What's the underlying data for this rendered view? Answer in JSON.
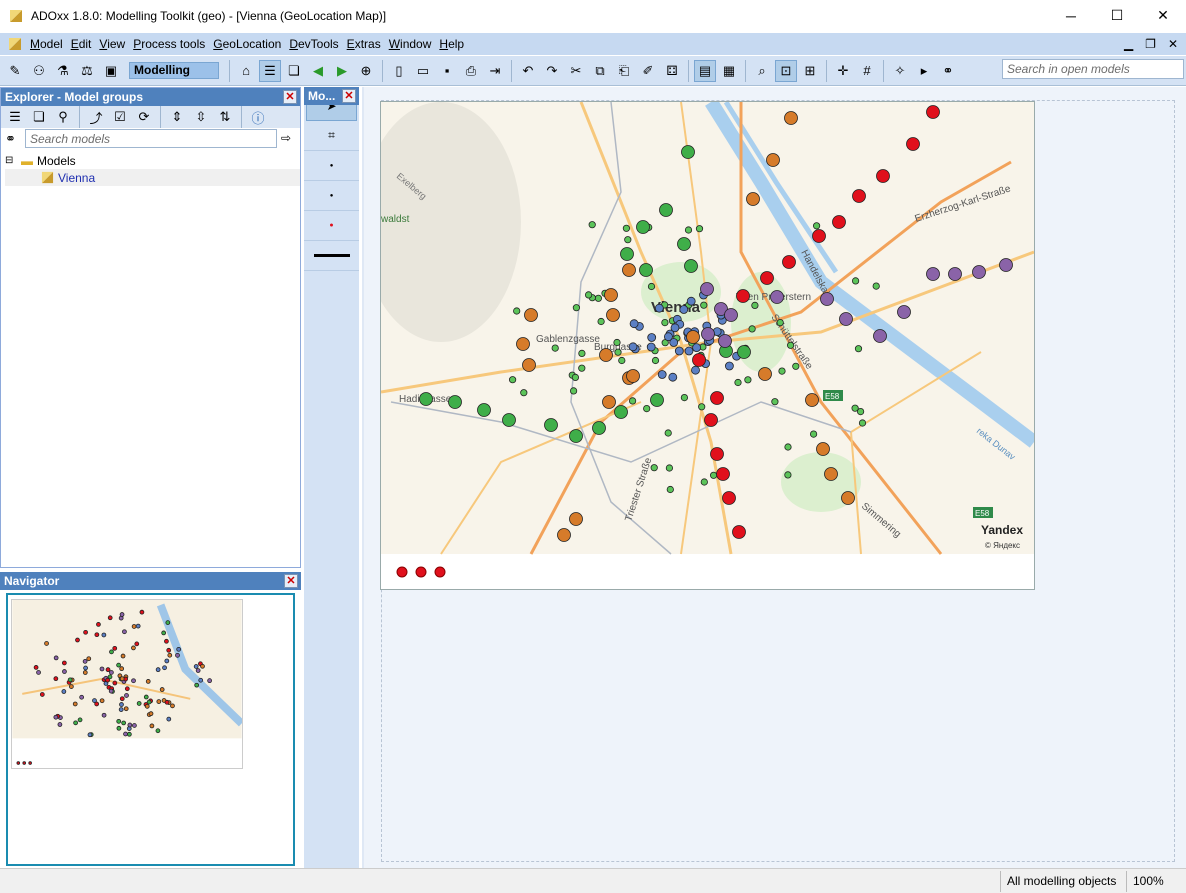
{
  "window": {
    "title": "ADOxx 1.8.0: Modelling Toolkit (geo) - [Vienna (GeoLocation Map)]",
    "minimize": "─",
    "maximize": "☐",
    "close": "✕"
  },
  "menu": [
    "Model",
    "Edit",
    "View",
    "Process tools",
    "GeoLocation",
    "DevTools",
    "Extras",
    "Window",
    "Help"
  ],
  "toolbar": {
    "mode": "Modelling",
    "search_placeholder": "Search in open models"
  },
  "explorer": {
    "title": "Explorer - Model groups",
    "search_placeholder": "Search models",
    "tree": {
      "root": "Models",
      "child": "Vienna"
    }
  },
  "palette": {
    "title": "Mo..."
  },
  "navigator": {
    "title": "Navigator"
  },
  "map": {
    "labels": [
      "Vienna",
      "Gablenzgasse",
      "Burggasse",
      "Handelskai",
      "Wien Praterstern",
      "Erzherzog-Karl-Straße",
      "Schüttelstraße",
      "Triester Straße",
      "Simmering",
      "Exelberg",
      "waldst",
      "Hadikgasse",
      "E58",
      "reka Dunav"
    ],
    "brand": "Yandex",
    "copyright": "© Яндекс"
  },
  "status": {
    "filter": "All modelling objects",
    "zoom": "100%"
  },
  "colors": {
    "red": "#e0101c",
    "orange": "#d67b2a",
    "green": "#3fae49",
    "purple": "#8a63a8",
    "blue": "#5b7fc4",
    "lightgreen": "#5cc45a"
  }
}
